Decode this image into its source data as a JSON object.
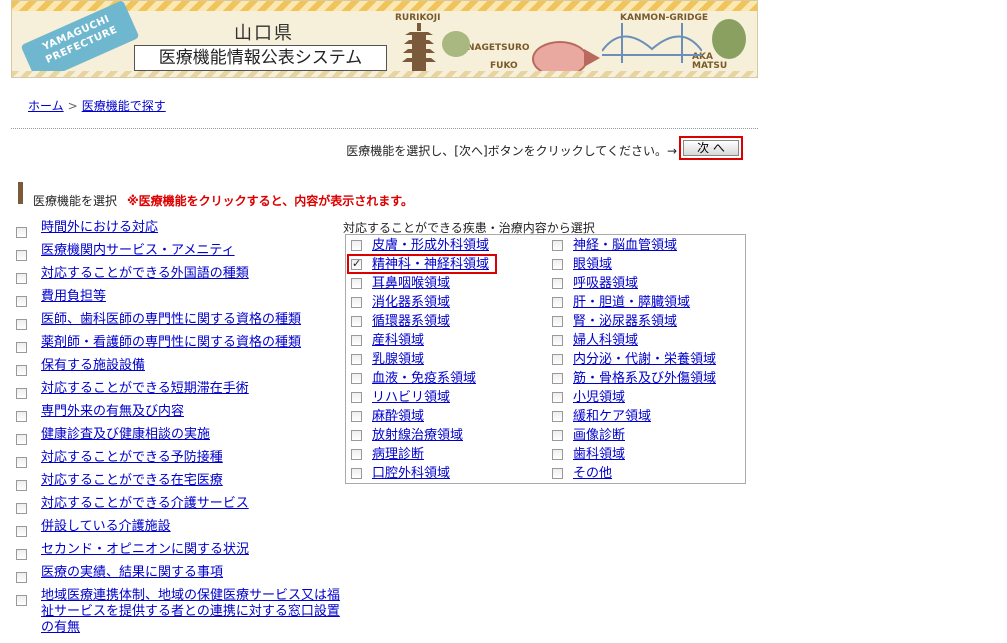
{
  "banner": {
    "prefecture_badge": "YAMAGUCHI PREFECTURE",
    "pref_name": "山口県",
    "system_title": "医療機能情報公表システム",
    "labels": [
      "RURIKOJI",
      "NAGETSURO",
      "FUKO",
      "KANMON-GRIDGE",
      "AKA MATSU"
    ]
  },
  "breadcrumb": {
    "home": "ホーム",
    "separator": ">",
    "current": "医療機能で探す"
  },
  "instruction": "医療機能を選択し、[次へ]ボタンをクリックしてください。→",
  "next_button": "次 へ",
  "section": {
    "title": "医療機能を選択",
    "note": "※医療機能をクリックすると、内容が表示されます。"
  },
  "left_items": [
    "時間外における対応",
    "医療機関内サービス・アメニティ",
    "対応することができる外国語の種類",
    "費用負担等",
    "医師、歯科医師の専門性に関する資格の種類",
    "薬剤師・看護師の専門性に関する資格の種類",
    "保有する施設設備",
    "対応することができる短期滞在手術",
    "専門外来の有無及び内容",
    "健康診査及び健康相談の実施",
    "対応することができる予防接種",
    "対応することができる在宅医療",
    "対応することができる介護サービス",
    "併設している介護施設",
    "セカンド・オピニオンに関する状況",
    "医療の実績、結果に関する事項",
    "地域医療連携体制、地域の保健医療サービス又は福祉サービスを提供する者との連携に対する窓口設置の有無"
  ],
  "right_panel": {
    "label": "対応することができる疾患・治療内容から選択",
    "col1": [
      {
        "label": "皮膚・形成外科領域",
        "checked": false
      },
      {
        "label": "精神科・神経科領域",
        "checked": true
      },
      {
        "label": "耳鼻咽喉領域",
        "checked": false
      },
      {
        "label": "消化器系領域",
        "checked": false
      },
      {
        "label": "循環器系領域",
        "checked": false
      },
      {
        "label": "産科領域",
        "checked": false
      },
      {
        "label": "乳腺領域",
        "checked": false
      },
      {
        "label": "血液・免疫系領域",
        "checked": false
      },
      {
        "label": "リハビリ領域",
        "checked": false
      },
      {
        "label": "麻酔領域",
        "checked": false
      },
      {
        "label": "放射線治療領域",
        "checked": false
      },
      {
        "label": "病理診断",
        "checked": false
      },
      {
        "label": "口腔外科領域",
        "checked": false
      }
    ],
    "col2": [
      {
        "label": "神経・脳血管領域",
        "checked": false
      },
      {
        "label": "眼領域",
        "checked": false
      },
      {
        "label": "呼吸器領域",
        "checked": false
      },
      {
        "label": "肝・胆道・膵臓領域",
        "checked": false
      },
      {
        "label": "腎・泌尿器系領域",
        "checked": false
      },
      {
        "label": "婦人科領域",
        "checked": false
      },
      {
        "label": "内分泌・代謝・栄養領域",
        "checked": false
      },
      {
        "label": "筋・骨格系及び外傷領域",
        "checked": false
      },
      {
        "label": "小児領域",
        "checked": false
      },
      {
        "label": "緩和ケア領域",
        "checked": false
      },
      {
        "label": "画像診断",
        "checked": false
      },
      {
        "label": "歯科領域",
        "checked": false
      },
      {
        "label": "その他",
        "checked": false
      }
    ]
  },
  "colors": {
    "link": "#0000cc",
    "highlight": "#dd0000",
    "section_bar": "#7a5a3a"
  }
}
